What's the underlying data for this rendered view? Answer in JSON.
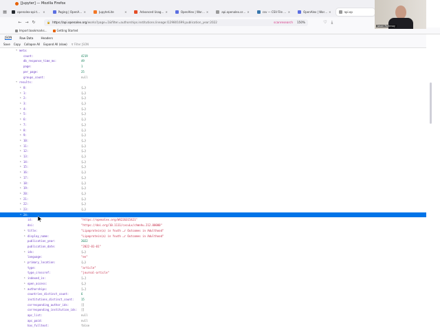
{
  "window": {
    "title": "[Jupyter] — Mozilla Firefox"
  },
  "tabs": [
    {
      "label": "openalex-api-tutorials",
      "color": "#24292f"
    },
    {
      "label": "Paging | OpenAlex te",
      "color": "#5b6ee1"
    },
    {
      "label": "JupyterLite",
      "color": "#f37726"
    },
    {
      "label": "Advanced Usage - scho",
      "color": "#e44d26"
    },
    {
      "label": "OpenAlex | Works sea",
      "color": "#5b6ee1"
    },
    {
      "label": "api.openalex.org/work",
      "color": "#999999"
    },
    {
      "label": "csv — CSV File Readi",
      "color": "#3776ab"
    },
    {
      "label": "OpenAlex | Works sea",
      "color": "#5b6ee1"
    },
    {
      "label": "api.op",
      "color": "#999999",
      "active": true
    }
  ],
  "nav": {
    "url_host": "https://api.openalex.org",
    "url_path": "/works?page=1&filter=authorships.institutions.lineage:I129801699,publication_year:2022",
    "zoom": "150%",
    "ext_label": "scanresearch"
  },
  "bookmarks": [
    "Import bookmarks...",
    "Getting Started"
  ],
  "viewer_tabs": [
    "JSON",
    "Raw Data",
    "Headers"
  ],
  "toolbar": [
    "Save",
    "Copy",
    "Collapse All",
    "Expand All (slow)"
  ],
  "filter_placeholder": "Filter JSON",
  "webcam_name": "Jason Portenoy",
  "rows": [
    {
      "k": "meta:",
      "v": "",
      "ind": 0,
      "tw": "▾"
    },
    {
      "k": "count:",
      "v": "4219",
      "ind": 1,
      "t": "num"
    },
    {
      "k": "db_response_time_ms:",
      "v": "49",
      "ind": 1,
      "t": "num"
    },
    {
      "k": "page:",
      "v": "1",
      "ind": 1,
      "t": "num"
    },
    {
      "k": "per_page:",
      "v": "25",
      "ind": 1,
      "t": "num"
    },
    {
      "k": "groups_count:",
      "v": "null",
      "ind": 1,
      "t": "nul"
    },
    {
      "k": "results:",
      "v": "",
      "ind": 0,
      "tw": "▾"
    },
    {
      "k": "0:",
      "v": "{…}",
      "ind": 1,
      "tw": "▸"
    },
    {
      "k": "1:",
      "v": "{…}",
      "ind": 1,
      "tw": "▸"
    },
    {
      "k": "2:",
      "v": "{…}",
      "ind": 1,
      "tw": "▸"
    },
    {
      "k": "3:",
      "v": "{…}",
      "ind": 1,
      "tw": "▸"
    },
    {
      "k": "4:",
      "v": "{…}",
      "ind": 1,
      "tw": "▸"
    },
    {
      "k": "5:",
      "v": "{…}",
      "ind": 1,
      "tw": "▸"
    },
    {
      "k": "6:",
      "v": "{…}",
      "ind": 1,
      "tw": "▸"
    },
    {
      "k": "7:",
      "v": "{…}",
      "ind": 1,
      "tw": "▸"
    },
    {
      "k": "8:",
      "v": "{…}",
      "ind": 1,
      "tw": "▸"
    },
    {
      "k": "9:",
      "v": "{…}",
      "ind": 1,
      "tw": "▸"
    },
    {
      "k": "10:",
      "v": "{…}",
      "ind": 1,
      "tw": "▸"
    },
    {
      "k": "11:",
      "v": "{…}",
      "ind": 1,
      "tw": "▸"
    },
    {
      "k": "12:",
      "v": "{…}",
      "ind": 1,
      "tw": "▸"
    },
    {
      "k": "13:",
      "v": "{…}",
      "ind": 1,
      "tw": "▸"
    },
    {
      "k": "14:",
      "v": "{…}",
      "ind": 1,
      "tw": "▸"
    },
    {
      "k": "15:",
      "v": "{…}",
      "ind": 1,
      "tw": "▸"
    },
    {
      "k": "16:",
      "v": "{…}",
      "ind": 1,
      "tw": "▸"
    },
    {
      "k": "17:",
      "v": "{…}",
      "ind": 1,
      "tw": "▸"
    },
    {
      "k": "18:",
      "v": "{…}",
      "ind": 1,
      "tw": "▸"
    },
    {
      "k": "19:",
      "v": "{…}",
      "ind": 1,
      "tw": "▸"
    },
    {
      "k": "20:",
      "v": "{…}",
      "ind": 1,
      "tw": "▸"
    },
    {
      "k": "21:",
      "v": "{…}",
      "ind": 1,
      "tw": "▸"
    },
    {
      "k": "22:",
      "v": "{…}",
      "ind": 1,
      "tw": "▸"
    },
    {
      "k": "23:",
      "v": "{…}",
      "ind": 1,
      "tw": "▸"
    },
    {
      "k": "24:",
      "v": "",
      "ind": 1,
      "tw": "▾",
      "sel": true
    },
    {
      "k": "id:",
      "v": "\"https://openalex.org/W4226315421\"",
      "ind": 2,
      "t": "str"
    },
    {
      "k": "doi:",
      "v": "\"https://doi.org/10.1111/cvcuLx/chmnhu.212.00000\"",
      "ind": 2,
      "t": "str"
    },
    {
      "k": "title:",
      "v": "\"Lipoprotein(a) in Youth …r Outcomes in Adulthood\"",
      "ind": 2,
      "t": "str",
      "tw": "▸"
    },
    {
      "k": "display_name:",
      "v": "\"Lipoprotein(a) in Youth …r Outcomes in Adulthood\"",
      "ind": 2,
      "t": "str",
      "tw": "▸"
    },
    {
      "k": "publication_year:",
      "v": "2022",
      "ind": 2,
      "t": "num"
    },
    {
      "k": "publication_date:",
      "v": "\"2022-01-01\"",
      "ind": 2,
      "t": "str"
    },
    {
      "k": "ids:",
      "v": "{…}",
      "ind": 2,
      "tw": "▸"
    },
    {
      "k": "language:",
      "v": "\"en\"",
      "ind": 2,
      "t": "str"
    },
    {
      "k": "primary_location:",
      "v": "{…}",
      "ind": 2,
      "tw": "▸"
    },
    {
      "k": "type:",
      "v": "\"article\"",
      "ind": 2,
      "t": "str"
    },
    {
      "k": "type_crossref:",
      "v": "\"journal-article\"",
      "ind": 2,
      "t": "str"
    },
    {
      "k": "indexed_in:",
      "v": "[…]",
      "ind": 2,
      "tw": "▸"
    },
    {
      "k": "open_access:",
      "v": "{…}",
      "ind": 2,
      "tw": "▸"
    },
    {
      "k": "authorships:",
      "v": "[…]",
      "ind": 2,
      "tw": "▸"
    },
    {
      "k": "countries_distinct_count:",
      "v": "6",
      "ind": 2,
      "t": "num"
    },
    {
      "k": "institutions_distinct_count:",
      "v": "15",
      "ind": 2,
      "t": "num"
    },
    {
      "k": "corresponding_author_ids:",
      "v": "[]",
      "ind": 2
    },
    {
      "k": "corresponding_institution_ids:",
      "v": "[]",
      "ind": 2
    },
    {
      "k": "apc_list:",
      "v": "null",
      "ind": 2,
      "t": "nul"
    },
    {
      "k": "apc_paid:",
      "v": "null",
      "ind": 2,
      "t": "nul"
    },
    {
      "k": "has_fulltext:",
      "v": "false",
      "ind": 2,
      "t": "nul"
    }
  ]
}
